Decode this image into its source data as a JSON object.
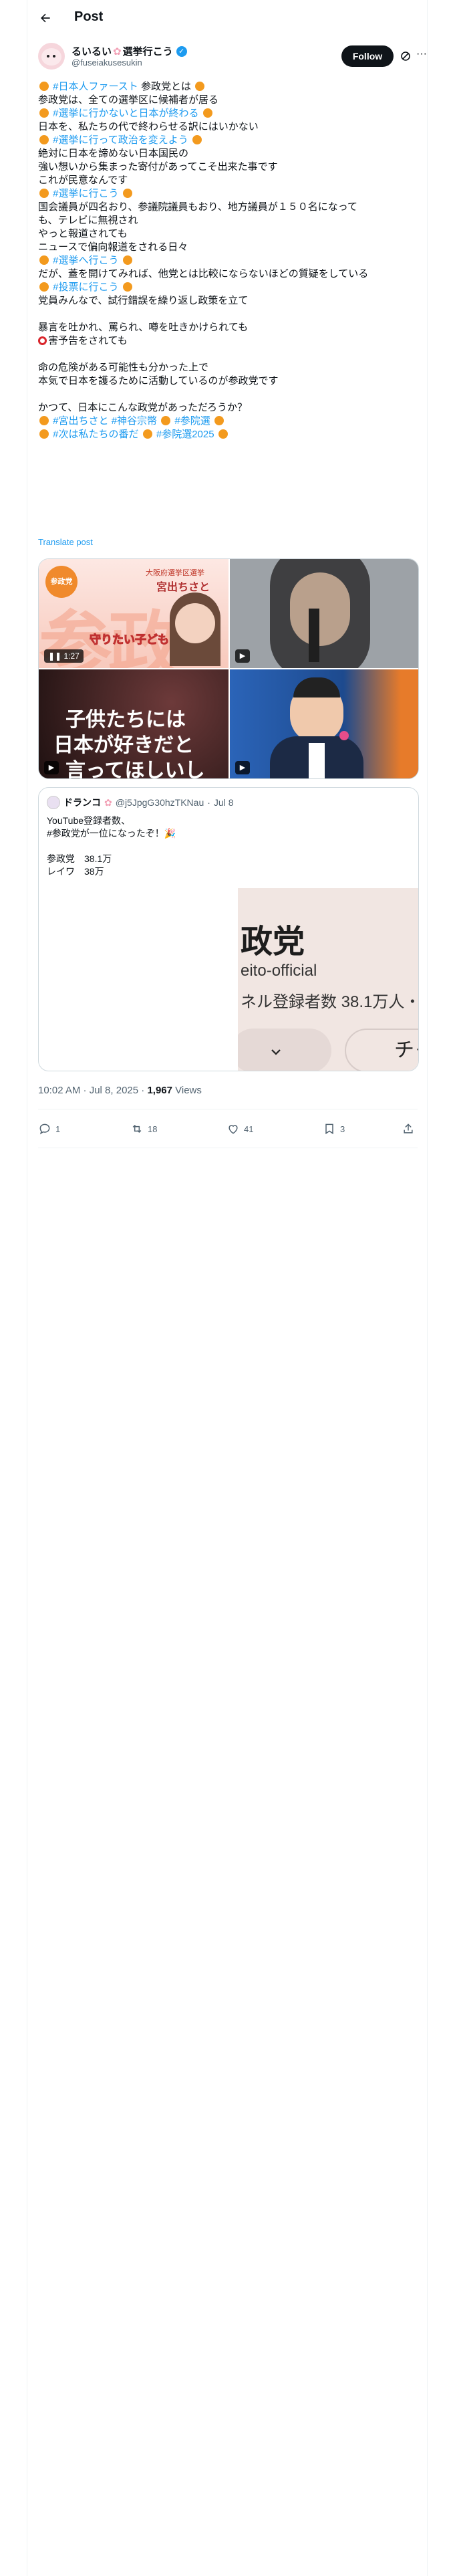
{
  "header": {
    "title": "Post"
  },
  "author": {
    "name": "るいるい",
    "name_suffix": "選挙行こう",
    "handle": "@fuseiakusesukin",
    "follow_label": "Follow"
  },
  "post": {
    "line1": "#日本人ファースト",
    "line1b": "参政党とは",
    "line2": "参政党は、全ての選挙区に候補者が居る",
    "line3": "#選挙に行かないと日本が終わる",
    "line4": "日本を、私たちの代で終わらせる訳にはいかない",
    "line5": "#選挙に行って政治を変えよう",
    "line6": "絶対に日本を諦めない日本国民の",
    "line7": "強い想いから集まった寄付があってこそ出来た事です",
    "line8": "これが民意なんです",
    "line9": "#選挙に行こう",
    "line10": "国会議員が四名おり、参議院議員もおり、地方議員が１５０名になって",
    "line11": "も、テレビに無視され",
    "line12": "やっと報道されても",
    "line13": "ニュースで偏向報道をされる日々",
    "line14": "#選挙へ行こう",
    "line15": "だが、蓋を開けてみれば、他党とは比較にならないほどの質疑をしている",
    "line16": "#投票に行こう",
    "line17": "党員みんなで、試行錯誤を繰り返し政策を立て",
    "line18": "暴言を吐かれ、罵られ、噂を吐きかけられても",
    "line19": "害予告をされても",
    "line20": "命の危険がある可能性も分かった上で",
    "line21": "本気で日本を護るために活動しているのが参政党です",
    "line22": "かつて、日本にこんな政党があっただろうか？",
    "line23a": "#宮出ちさと",
    "line23b": "#神谷宗幣",
    "line23c": "#参院選",
    "line24a": "#次は私たちの番だ",
    "line24b": "#参院選2025",
    "translate": "Translate post"
  },
  "media": {
    "tile1_badge": "参政党",
    "tile1_caption": "大阪府選挙区選挙",
    "tile1_name": "宮出ちさと",
    "tile1_overlay": "守りたい子ども",
    "tile1_duration": "1:27",
    "tile3_text1": "子供たちには",
    "tile3_text2": "日本が好きだと",
    "tile3_text3": "言ってほしいし"
  },
  "quote": {
    "name": "ドランコ",
    "handle": "@j5JpgG30hzTKNau",
    "date": "Jul 8",
    "line1": "YouTube登録者数、",
    "line2": "#参政党が一位になったぞ！",
    "line3": "参政党　38.1万",
    "line4": "レイワ　38万",
    "img_big": "政党",
    "img_sub1": "eito-official",
    "img_sub2": "ネル登録者数 38.1万人・",
    "img_pill": "チャ"
  },
  "meta": {
    "time": "10:02 AM · Jul 8, 2025 · ",
    "views_count": "1,967",
    "views_label": " Views"
  },
  "stats": {
    "replies": "1",
    "reposts": "18",
    "likes": "41",
    "bookmarks": "3"
  }
}
